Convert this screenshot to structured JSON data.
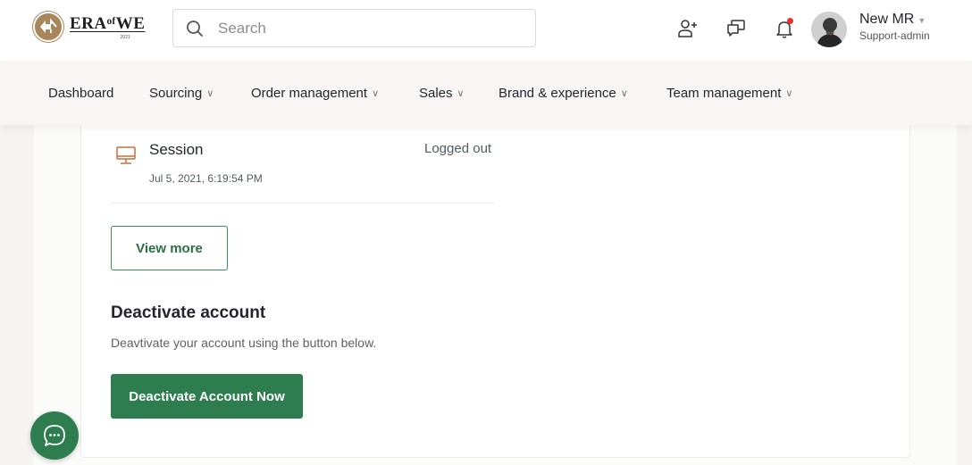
{
  "brand": {
    "name": "ERA of WE",
    "logo_word": "ERAᵒᶠWE",
    "logo_year": "2021"
  },
  "search": {
    "placeholder": "Search"
  },
  "header_icons": [
    "add-user-icon",
    "chat-icon",
    "bell-icon"
  ],
  "user": {
    "name": "New MR",
    "role": "Support-admin"
  },
  "nav": {
    "items": [
      {
        "label": "Dashboard",
        "has_dropdown": false
      },
      {
        "label": "Sourcing",
        "has_dropdown": true
      },
      {
        "label": "Order management",
        "has_dropdown": true
      },
      {
        "label": "Sales",
        "has_dropdown": true
      },
      {
        "label": "Brand & experience",
        "has_dropdown": true
      },
      {
        "label": "Team management",
        "has_dropdown": true
      }
    ]
  },
  "session": {
    "title": "Session",
    "status": "Logged out",
    "time": "Jul 5, 2021, 6:19:54 PM",
    "icon": "monitor-icon"
  },
  "view_more_label": "View more",
  "deactivate": {
    "title": "Deactivate account",
    "description": "Deavtivate your account using the button below.",
    "button_label": "Deactivate Account Now"
  },
  "colors": {
    "primary": "#2e7d4f",
    "notification": "#e5332f",
    "logo": "#a8865a"
  }
}
